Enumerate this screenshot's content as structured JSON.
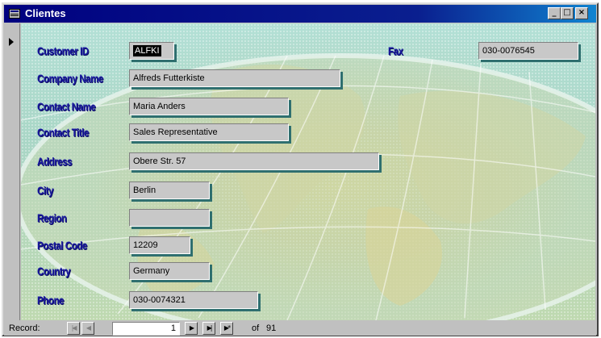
{
  "window": {
    "title": "Clientes"
  },
  "title_buttons": {
    "minimize": "_",
    "maximize": "□",
    "close": "×"
  },
  "form": {
    "fields": {
      "customer_id": {
        "label": "Customer ID",
        "value": "ALFKI"
      },
      "fax": {
        "label": "Fax",
        "value": "030-0076545"
      },
      "company_name": {
        "label": "Company Name",
        "value": "Alfreds Futterkiste"
      },
      "contact_name": {
        "label": "Contact Name",
        "value": "Maria Anders"
      },
      "contact_title": {
        "label": "Contact Title",
        "value": "Sales Representative"
      },
      "address": {
        "label": "Address",
        "value": "Obere Str. 57"
      },
      "city": {
        "label": "City",
        "value": "Berlin"
      },
      "region": {
        "label": "Region",
        "value": ""
      },
      "postal_code": {
        "label": "Postal Code",
        "value": "12209"
      },
      "country": {
        "label": "Country",
        "value": "Germany"
      },
      "phone": {
        "label": "Phone",
        "value": "030-0074321"
      }
    }
  },
  "navigation": {
    "record_label": "Record:",
    "current": "1",
    "of_label": "of",
    "total": "91",
    "buttons": {
      "first": "|◀",
      "prev": "◀",
      "next": "▶",
      "last": "▶|",
      "new": "▶*"
    }
  },
  "colors": {
    "title_bar": "#000080",
    "label_text": "#1a1aa0",
    "form_background": "#9fd4c4"
  }
}
